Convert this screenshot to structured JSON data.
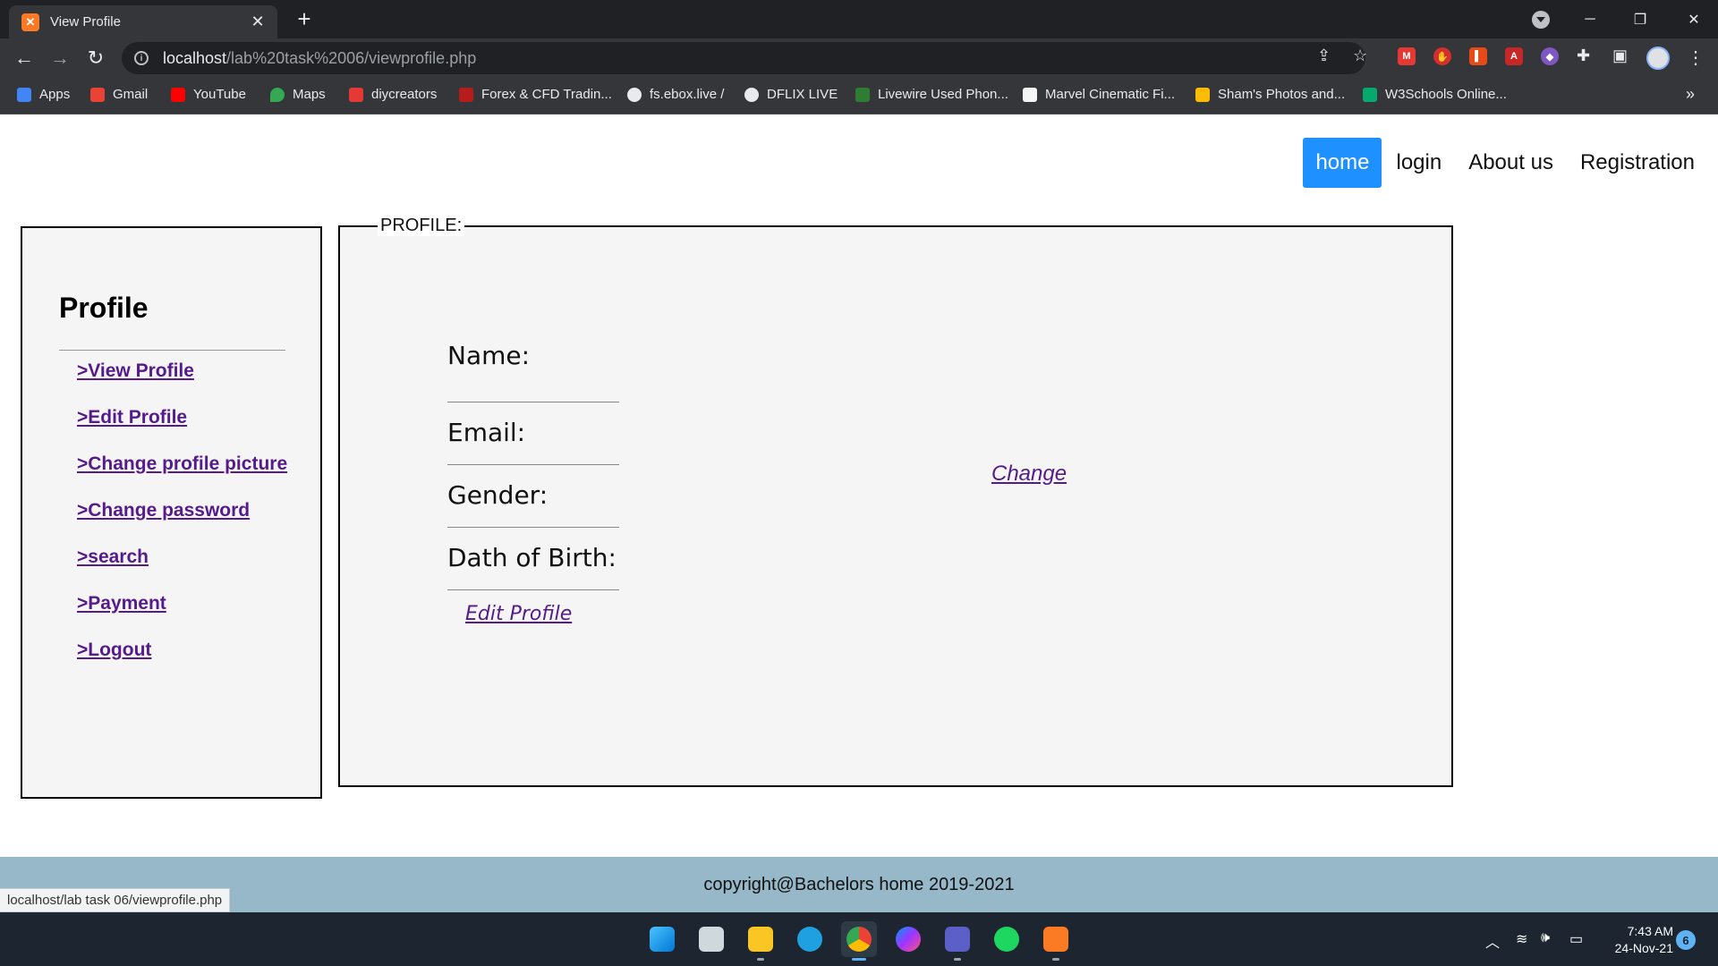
{
  "browser": {
    "tab_title": "View Profile",
    "tab_favicon_icon": "xampp-icon",
    "url_host": "localhost",
    "url_path": "/lab%20task%2006/viewprofile.php",
    "bookmarks": [
      {
        "label": "Apps",
        "color": "#4285f4"
      },
      {
        "label": "Gmail",
        "color": "#ea4335"
      },
      {
        "label": "YouTube",
        "color": "#ff0000"
      },
      {
        "label": "Maps",
        "color": "#34a853"
      },
      {
        "label": "diycreators",
        "color": "#e53935"
      },
      {
        "label": "Forex & CFD Tradin...",
        "color": "#b71c1c"
      },
      {
        "label": "fs.ebox.live /",
        "color": "#e8eaed"
      },
      {
        "label": "DFLIX LIVE",
        "color": "#e8eaed"
      },
      {
        "label": "Livewire Used Phon...",
        "color": "#2e7d32"
      },
      {
        "label": "Marvel Cinematic Fi...",
        "color": "#f5f5f5"
      },
      {
        "label": "Sham's Photos and...",
        "color": "#fbbc04"
      },
      {
        "label": "W3Schools Online...",
        "color": "#04aa6d"
      }
    ]
  },
  "nav": {
    "home": "home",
    "login": "login",
    "about": "About us",
    "registration": "Registration"
  },
  "sidebar": {
    "title": "Profile",
    "links": [
      ">View Profile",
      ">Edit Profile",
      ">Change profile picture",
      ">Change password",
      ">search",
      ">Payment",
      ">Logout"
    ]
  },
  "profile": {
    "legend": "PROFILE:",
    "fields": [
      "Name:",
      "Email:",
      "Gender:",
      "Dath of Birth:"
    ],
    "edit_link": "Edit Profile",
    "change_link": "Change"
  },
  "footer": {
    "text": "copyright@Bachelors home 2019-2021"
  },
  "status_url": "localhost/lab task 06/viewprofile.php",
  "taskbar": {
    "time": "7:43 AM",
    "date": "24-Nov-21",
    "notifications": "6"
  }
}
